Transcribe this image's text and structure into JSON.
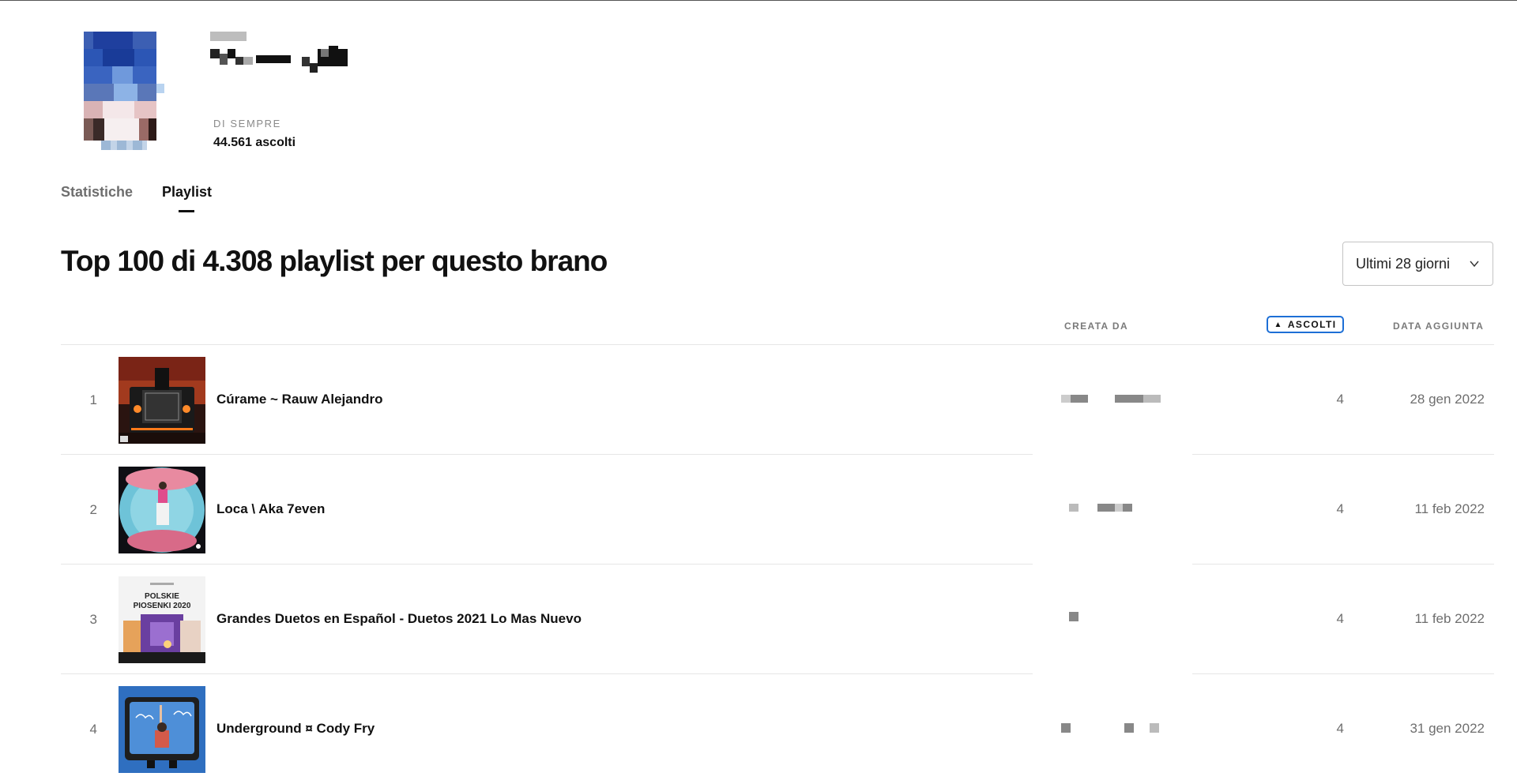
{
  "header": {
    "period_label": "DI SEMPRE",
    "plays_total": "44.561 ascolti"
  },
  "tabs": [
    {
      "label": "Statistiche",
      "active": false
    },
    {
      "label": "Playlist",
      "active": true
    }
  ],
  "section": {
    "heading": "Top 100 di 4.308 playlist per questo brano",
    "range_selected": "Ultimi 28 giorni"
  },
  "table": {
    "columns": {
      "creator": "CREATA DA",
      "plays": "ASCOLTI",
      "date": "DATA AGGIUNTA"
    },
    "sort": {
      "column": "plays",
      "direction": "ascending"
    },
    "rows": [
      {
        "rank": "1",
        "name": "Cúrame ~ Rauw Alejandro",
        "plays": "4",
        "date": "28 gen 2022"
      },
      {
        "rank": "2",
        "name": "Loca \\ Aka 7even",
        "plays": "4",
        "date": "11 feb 2022"
      },
      {
        "rank": "3",
        "name": "Grandes Duetos en Español - Duetos 2021 Lo Mas Nuevo",
        "plays": "4",
        "date": "11 feb 2022",
        "cover_text": [
          "POLSKIE",
          "PIOSENKI 2020"
        ]
      },
      {
        "rank": "4",
        "name": "Underground ¤ Cody Fry",
        "plays": "4",
        "date": "31 gen 2022"
      }
    ]
  },
  "icons": {
    "dropdown": "chevron-down-icon",
    "sort": "sort-up-icon"
  },
  "colors": {
    "accent": "#1d6fd6",
    "text": "#111111",
    "muted": "#6e6e6e"
  }
}
